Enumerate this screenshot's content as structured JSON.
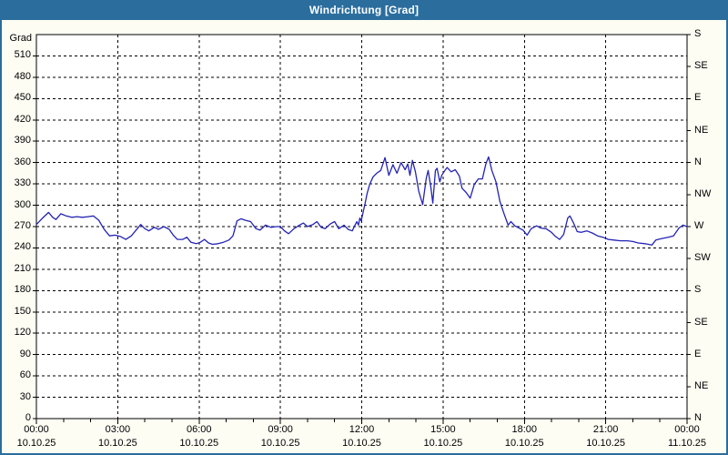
{
  "window": {
    "title": "Windrichtung [Grad]"
  },
  "colors": {
    "titlebar_bg": "#2b6e9e",
    "titlebar_text": "#ffffff",
    "window_border": "#2b6e9e",
    "page_bg": "#fdfdf4",
    "plot_bg": "#ffffff",
    "plot_border": "#000000",
    "grid": "#000000",
    "axis_text": "#000000",
    "line": "#2323b4"
  },
  "chart_data": {
    "type": "line",
    "title": "Windrichtung [Grad]",
    "ylabel_left": "Grad",
    "ylim": [
      0,
      540
    ],
    "xlim_hours": [
      0,
      24
    ],
    "grid": "dashed",
    "legend_position": "none",
    "y_left_ticks": [
      0,
      30,
      60,
      90,
      120,
      150,
      180,
      210,
      240,
      270,
      300,
      330,
      360,
      390,
      420,
      450,
      480,
      510
    ],
    "y_right_ticks": [
      {
        "value": 540,
        "label": "S"
      },
      {
        "value": 495,
        "label": "SE"
      },
      {
        "value": 450,
        "label": "E"
      },
      {
        "value": 405,
        "label": "NE"
      },
      {
        "value": 360,
        "label": "N"
      },
      {
        "value": 315,
        "label": "NW"
      },
      {
        "value": 270,
        "label": "W"
      },
      {
        "value": 225,
        "label": "SW"
      },
      {
        "value": 180,
        "label": "S"
      },
      {
        "value": 135,
        "label": "SE"
      },
      {
        "value": 90,
        "label": "E"
      },
      {
        "value": 45,
        "label": "NE"
      },
      {
        "value": 0,
        "label": "N"
      }
    ],
    "x_ticks": [
      {
        "hours": 0,
        "time": "00:00",
        "date": "10.10.25"
      },
      {
        "hours": 3,
        "time": "03:00",
        "date": "10.10.25"
      },
      {
        "hours": 6,
        "time": "06:00",
        "date": "10.10.25"
      },
      {
        "hours": 9,
        "time": "09:00",
        "date": "10.10.25"
      },
      {
        "hours": 12,
        "time": "12:00",
        "date": "10.10.25"
      },
      {
        "hours": 15,
        "time": "15:00",
        "date": "10.10.25"
      },
      {
        "hours": 18,
        "time": "18:00",
        "date": "10.10.25"
      },
      {
        "hours": 21,
        "time": "21:00",
        "date": "10.10.25"
      },
      {
        "hours": 24,
        "time": "00:00",
        "date": "11.10.25"
      }
    ],
    "minor_x_tick_step_hours": 1,
    "series": [
      {
        "name": "Windrichtung",
        "unit": "Grad",
        "color": "#2323b4",
        "points": [
          [
            0,
            273
          ],
          [
            0.2,
            281
          ],
          [
            0.45,
            290
          ],
          [
            0.6,
            283
          ],
          [
            0.72,
            280
          ],
          [
            0.9,
            288
          ],
          [
            1.1,
            285
          ],
          [
            1.3,
            283
          ],
          [
            1.5,
            284
          ],
          [
            1.7,
            283
          ],
          [
            1.9,
            284
          ],
          [
            2.1,
            285
          ],
          [
            2.3,
            279
          ],
          [
            2.5,
            266
          ],
          [
            2.7,
            257
          ],
          [
            2.9,
            258
          ],
          [
            3.1,
            256
          ],
          [
            3.3,
            252
          ],
          [
            3.5,
            257
          ],
          [
            3.7,
            266
          ],
          [
            3.85,
            273
          ],
          [
            4.0,
            267
          ],
          [
            4.15,
            264
          ],
          [
            4.35,
            269
          ],
          [
            4.5,
            266
          ],
          [
            4.7,
            270
          ],
          [
            4.9,
            266
          ],
          [
            5.05,
            258
          ],
          [
            5.2,
            252
          ],
          [
            5.4,
            252
          ],
          [
            5.55,
            255
          ],
          [
            5.7,
            248
          ],
          [
            5.9,
            246
          ],
          [
            6.05,
            248
          ],
          [
            6.2,
            252
          ],
          [
            6.35,
            247
          ],
          [
            6.5,
            245
          ],
          [
            6.7,
            246
          ],
          [
            6.9,
            248
          ],
          [
            7.1,
            251
          ],
          [
            7.25,
            257
          ],
          [
            7.4,
            278
          ],
          [
            7.55,
            281
          ],
          [
            7.7,
            279
          ],
          [
            7.9,
            277
          ],
          [
            8.1,
            267
          ],
          [
            8.25,
            265
          ],
          [
            8.45,
            272
          ],
          [
            8.65,
            269
          ],
          [
            8.85,
            270
          ],
          [
            9.0,
            270
          ],
          [
            9.15,
            264
          ],
          [
            9.3,
            260
          ],
          [
            9.5,
            267
          ],
          [
            9.7,
            272
          ],
          [
            9.85,
            275
          ],
          [
            10.0,
            270
          ],
          [
            10.2,
            273
          ],
          [
            10.35,
            277
          ],
          [
            10.5,
            269
          ],
          [
            10.65,
            267
          ],
          [
            10.85,
            274
          ],
          [
            11.0,
            277
          ],
          [
            11.15,
            267
          ],
          [
            11.35,
            272
          ],
          [
            11.5,
            266
          ],
          [
            11.65,
            264
          ],
          [
            11.75,
            272
          ],
          [
            11.82,
            277
          ],
          [
            11.88,
            272
          ],
          [
            11.93,
            282
          ],
          [
            11.98,
            278
          ],
          [
            12.05,
            290
          ],
          [
            12.12,
            302
          ],
          [
            12.2,
            317
          ],
          [
            12.3,
            330
          ],
          [
            12.42,
            340
          ],
          [
            12.55,
            345
          ],
          [
            12.7,
            349
          ],
          [
            12.86,
            367
          ],
          [
            13.0,
            342
          ],
          [
            13.15,
            357
          ],
          [
            13.3,
            345
          ],
          [
            13.45,
            360
          ],
          [
            13.6,
            350
          ],
          [
            13.7,
            358
          ],
          [
            13.78,
            342
          ],
          [
            13.87,
            363
          ],
          [
            13.98,
            347
          ],
          [
            14.1,
            320
          ],
          [
            14.25,
            301
          ],
          [
            14.38,
            338
          ],
          [
            14.45,
            349
          ],
          [
            14.55,
            325
          ],
          [
            14.62,
            303
          ],
          [
            14.72,
            349
          ],
          [
            14.78,
            352
          ],
          [
            14.88,
            333
          ],
          [
            14.95,
            342
          ],
          [
            15.05,
            348
          ],
          [
            15.15,
            353
          ],
          [
            15.3,
            347
          ],
          [
            15.45,
            350
          ],
          [
            15.6,
            341
          ],
          [
            15.7,
            324
          ],
          [
            15.85,
            318
          ],
          [
            16.0,
            310
          ],
          [
            16.15,
            329
          ],
          [
            16.3,
            337
          ],
          [
            16.45,
            337
          ],
          [
            16.58,
            358
          ],
          [
            16.68,
            368
          ],
          [
            16.8,
            349
          ],
          [
            16.95,
            333
          ],
          [
            17.1,
            305
          ],
          [
            17.25,
            288
          ],
          [
            17.4,
            272
          ],
          [
            17.5,
            277
          ],
          [
            17.65,
            271
          ],
          [
            17.8,
            268
          ],
          [
            17.95,
            265
          ],
          [
            18.1,
            258
          ],
          [
            18.25,
            267
          ],
          [
            18.45,
            271
          ],
          [
            18.6,
            268
          ],
          [
            18.8,
            267
          ],
          [
            19.0,
            262
          ],
          [
            19.15,
            256
          ],
          [
            19.3,
            252
          ],
          [
            19.45,
            259
          ],
          [
            19.6,
            282
          ],
          [
            19.68,
            285
          ],
          [
            19.8,
            276
          ],
          [
            19.95,
            263
          ],
          [
            20.1,
            262
          ],
          [
            20.3,
            264
          ],
          [
            20.5,
            261
          ],
          [
            20.7,
            257
          ],
          [
            20.9,
            255
          ],
          [
            21.1,
            252
          ],
          [
            21.3,
            251
          ],
          [
            21.55,
            250
          ],
          [
            21.8,
            250
          ],
          [
            22.0,
            249
          ],
          [
            22.2,
            247
          ],
          [
            22.45,
            246
          ],
          [
            22.7,
            244
          ],
          [
            22.85,
            251
          ],
          [
            23.05,
            253
          ],
          [
            23.3,
            255
          ],
          [
            23.5,
            257
          ],
          [
            23.7,
            268
          ],
          [
            23.85,
            272
          ],
          [
            24.0,
            270
          ]
        ]
      }
    ]
  }
}
